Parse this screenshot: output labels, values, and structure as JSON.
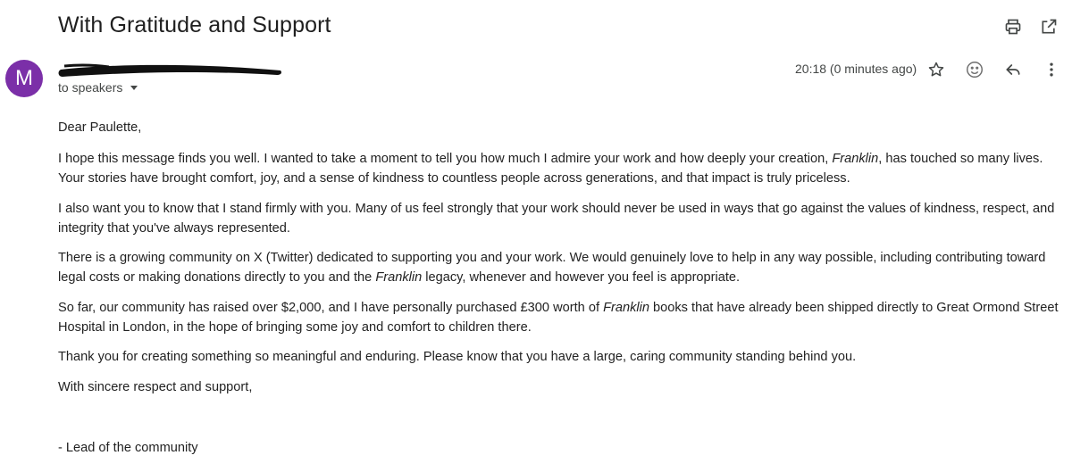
{
  "email": {
    "subject": "With Gratitude and Support",
    "avatar_letter": "M",
    "recipients": "to speakers",
    "timestamp": "20:18 (0 minutes ago)"
  },
  "icons": {
    "print": "print-icon",
    "open_new_window": "open-in-new-icon",
    "star": "star-icon",
    "emoji": "emoji-react-icon",
    "reply": "reply-icon",
    "more": "more-vertical-icon"
  },
  "colors": {
    "avatar": "#7b2fa8",
    "redaction": "#111111"
  },
  "body": {
    "greeting": "Dear Paulette,",
    "p1_a": "I hope this message finds you well. I wanted to take a moment to tell you how much I admire your work and how deeply your creation, ",
    "p1_em": "Franklin",
    "p1_b": ", has touched so many lives. Your stories have brought comfort, joy, and a sense of kindness to countless people across generations, and that impact is truly priceless.",
    "p2": "I also want you to know that I stand firmly with you. Many of us feel strongly that your work should never be used in ways that go against the values of kindness, respect, and integrity that you've always represented.",
    "p3_a": "There is a growing community on X (Twitter) dedicated to supporting you and your work. We would genuinely love to help in any way possible, including contributing toward legal costs or making donations directly to you and the ",
    "p3_em": "Franklin",
    "p3_b": " legacy, whenever and however you feel is appropriate.",
    "p4_a": "So far, our community has raised over $2,000, and I have personally purchased £300 worth of ",
    "p4_em": "Franklin",
    "p4_b": " books that have already been shipped directly to Great Ormond Street Hospital in London, in the hope of bringing some joy and comfort to children there.",
    "p5": "Thank you for creating something so meaningful and enduring. Please know that you have a large, caring community standing behind you.",
    "closing": "With sincere respect and support,",
    "signature": "- Lead of the community"
  }
}
